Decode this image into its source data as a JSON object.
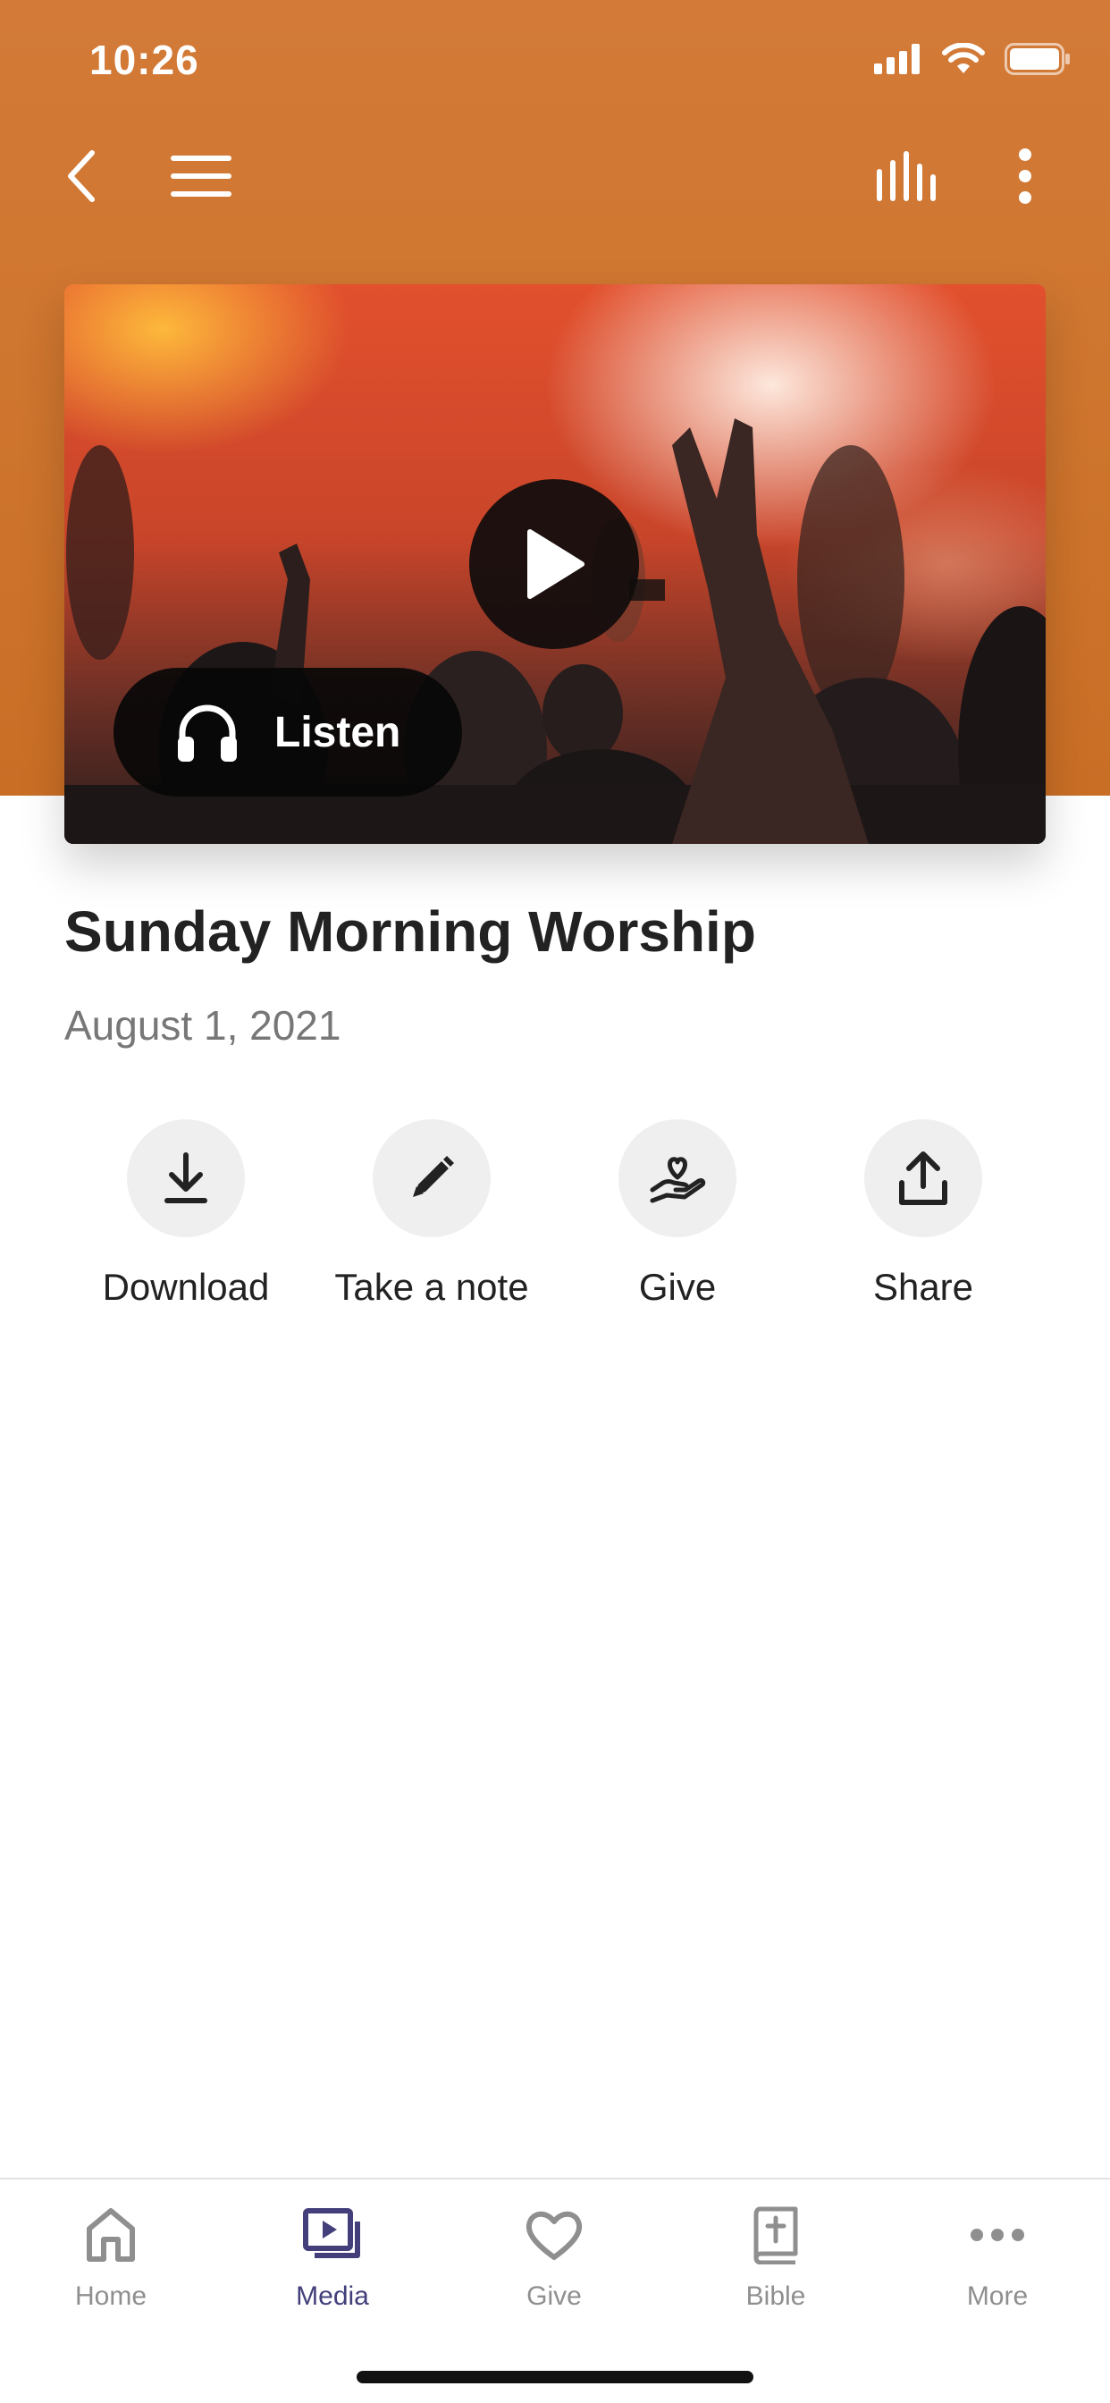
{
  "status_bar": {
    "time": "10:26"
  },
  "header": {
    "back_icon": "chevron-left-icon",
    "menu_icon": "hamburger-menu-icon",
    "audio_icon": "audio-bars-icon",
    "more_icon": "vertical-ellipsis-icon",
    "background_color": "#cf7630"
  },
  "media": {
    "play_icon": "play-icon",
    "listen_label": "Listen",
    "listen_icon": "headphones-icon"
  },
  "content": {
    "title": "Sunday Morning Worship",
    "date": "August 1, 2021"
  },
  "actions": [
    {
      "label": "Download",
      "icon": "download-icon"
    },
    {
      "label": "Take a note",
      "icon": "pencil-icon"
    },
    {
      "label": "Give",
      "icon": "hand-heart-icon"
    },
    {
      "label": "Share",
      "icon": "share-icon"
    }
  ],
  "tabbar": {
    "active_color": "#423f7a",
    "inactive_color": "#8f8f8f",
    "items": [
      {
        "label": "Home",
        "icon": "home-icon",
        "active": false
      },
      {
        "label": "Media",
        "icon": "media-icon",
        "active": true
      },
      {
        "label": "Give",
        "icon": "heart-icon",
        "active": false
      },
      {
        "label": "Bible",
        "icon": "bible-icon",
        "active": false
      },
      {
        "label": "More",
        "icon": "more-horizontal-icon",
        "active": false
      }
    ]
  }
}
